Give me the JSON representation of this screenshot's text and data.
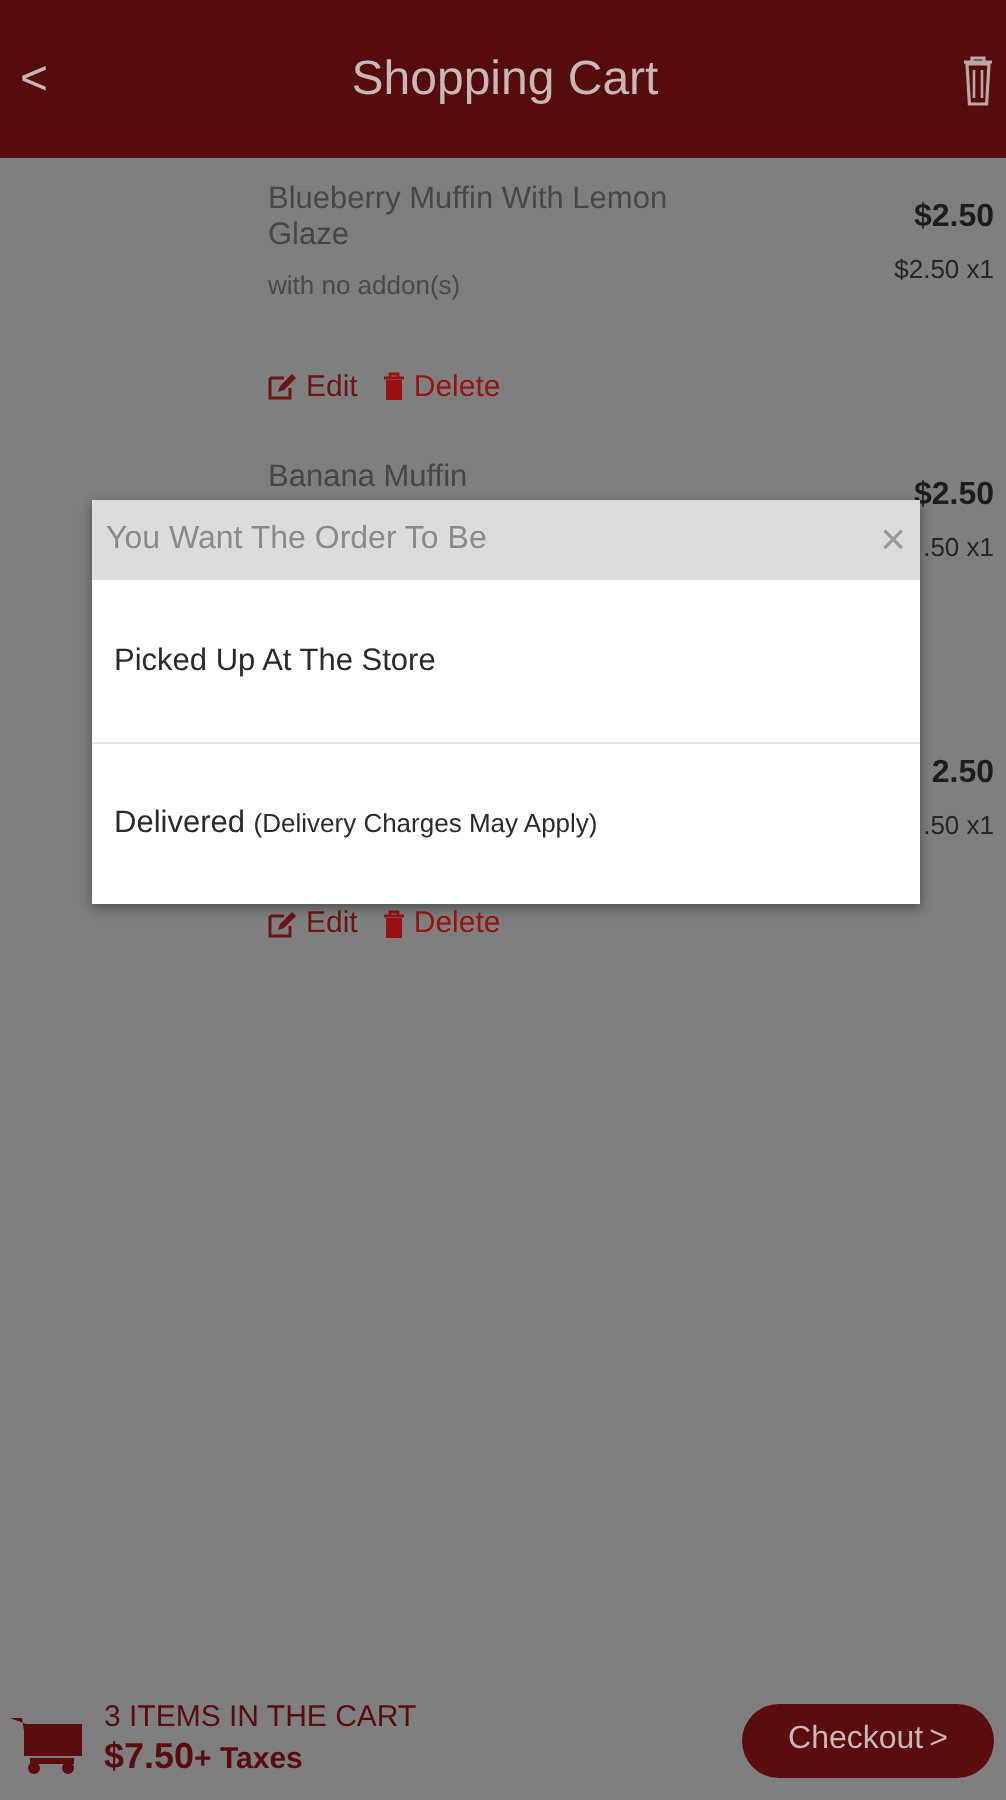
{
  "header": {
    "back": "<",
    "title": "Shopping Cart"
  },
  "cart_items": [
    {
      "name": "Blueberry Muffin With Lemon Glaze",
      "addons": "with no addon(s)",
      "price": "$2.50",
      "unit": "$2.50 x1",
      "actions": [
        "Edit",
        "Delete"
      ]
    },
    {
      "name": "Banana Muffin",
      "price": "$2.50",
      "unit": ".50 x1"
    },
    {
      "price": "2.50",
      "unit": ".50 x1",
      "actions": [
        "Edit",
        "Delete"
      ]
    }
  ],
  "dialog": {
    "title": "You Want The Order To Be",
    "close": "×",
    "options": [
      {
        "label": "Picked Up At The Store"
      },
      {
        "label": "Delivered",
        "note": "(Delivery Charges May Apply)"
      }
    ]
  },
  "footer": {
    "count": "3 ITEMS IN THE CART",
    "total": "$7.50",
    "taxes": "+ Taxes",
    "checkout": "Checkout",
    "checkout_arrow": ">"
  }
}
